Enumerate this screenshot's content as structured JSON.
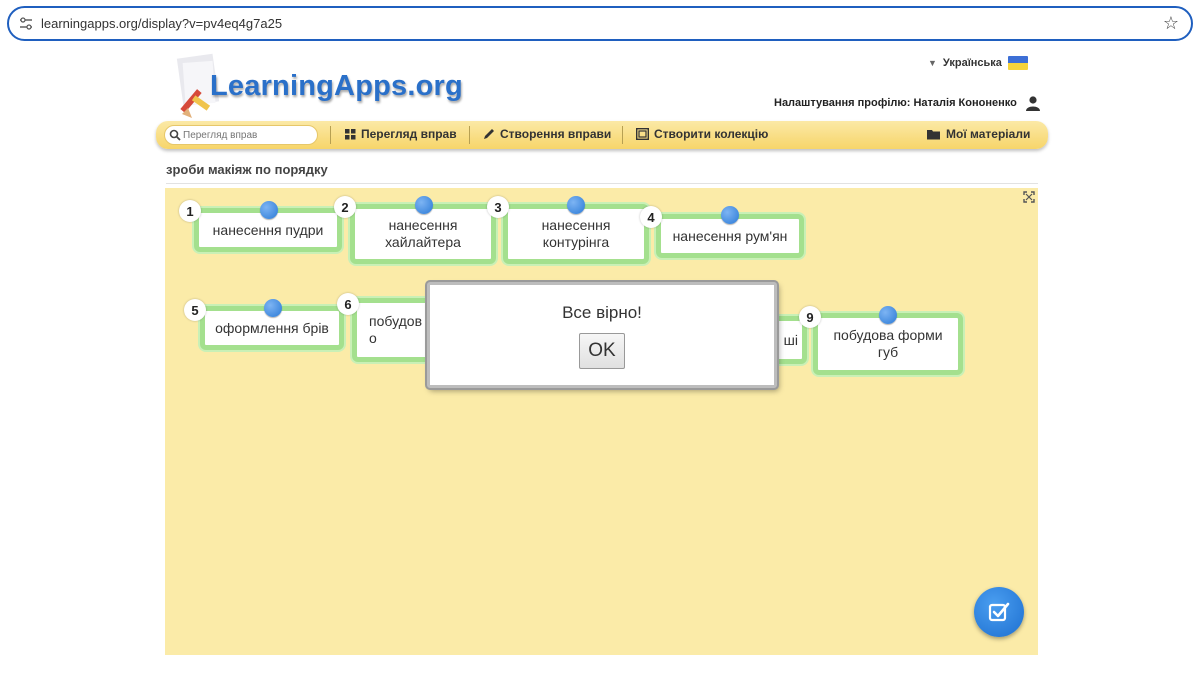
{
  "browser": {
    "url": "learningapps.org/display?v=pv4eq4g7a25"
  },
  "header": {
    "logo_text": "LearningApps.org",
    "language": "Українська",
    "profile_label": "Налаштування профілю: Наталія Кононенко"
  },
  "nav": {
    "search_placeholder": "Перегляд вправ",
    "items": [
      {
        "label": "Перегляд вправ",
        "icon": "grid-icon"
      },
      {
        "label": "Створення вправи",
        "icon": "pencil-icon"
      },
      {
        "label": "Створити колекцію",
        "icon": "collection-icon"
      },
      {
        "label": "Мої матеріали",
        "icon": "folder-icon"
      }
    ]
  },
  "exercise": {
    "title": "зроби макіяж по порядку",
    "cards": [
      {
        "number": "1",
        "text": "нанесення пудри"
      },
      {
        "number": "2",
        "text": "нанесення хайлайтера"
      },
      {
        "number": "3",
        "text": "нанесення контурінга"
      },
      {
        "number": "4",
        "text": "нанесення рум'ян"
      },
      {
        "number": "5",
        "text": "оформлення брів"
      },
      {
        "number": "6",
        "text": "побудов о"
      },
      {
        "number": "",
        "text": "ші"
      },
      {
        "number": "9",
        "text": "побудова форми губ"
      }
    ],
    "dialog": {
      "message": "Все вірно!",
      "ok_label": "OK"
    }
  },
  "colors": {
    "game_bg": "#fbeba8",
    "card_border": "#a4e08e",
    "accent_blue": "#2b7ad6",
    "nav_bg": "#f7d56a"
  }
}
